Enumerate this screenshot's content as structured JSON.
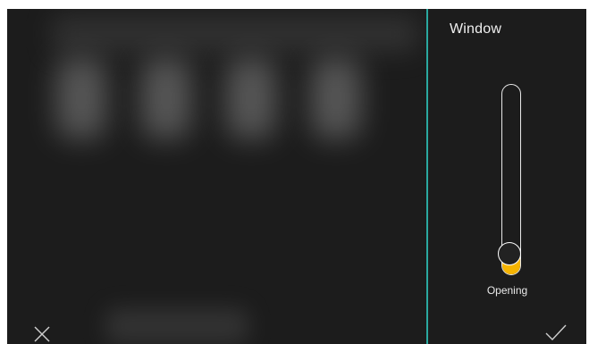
{
  "panel": {
    "title": "Window",
    "slider": {
      "label": "Opening",
      "value_fraction": 0.05
    }
  },
  "icons": {
    "close": "close-icon",
    "confirm": "checkmark-icon"
  },
  "colors": {
    "accent_border": "#2aa9a0",
    "slider_fill": "#f5b400",
    "background": "#1c1c1c"
  }
}
